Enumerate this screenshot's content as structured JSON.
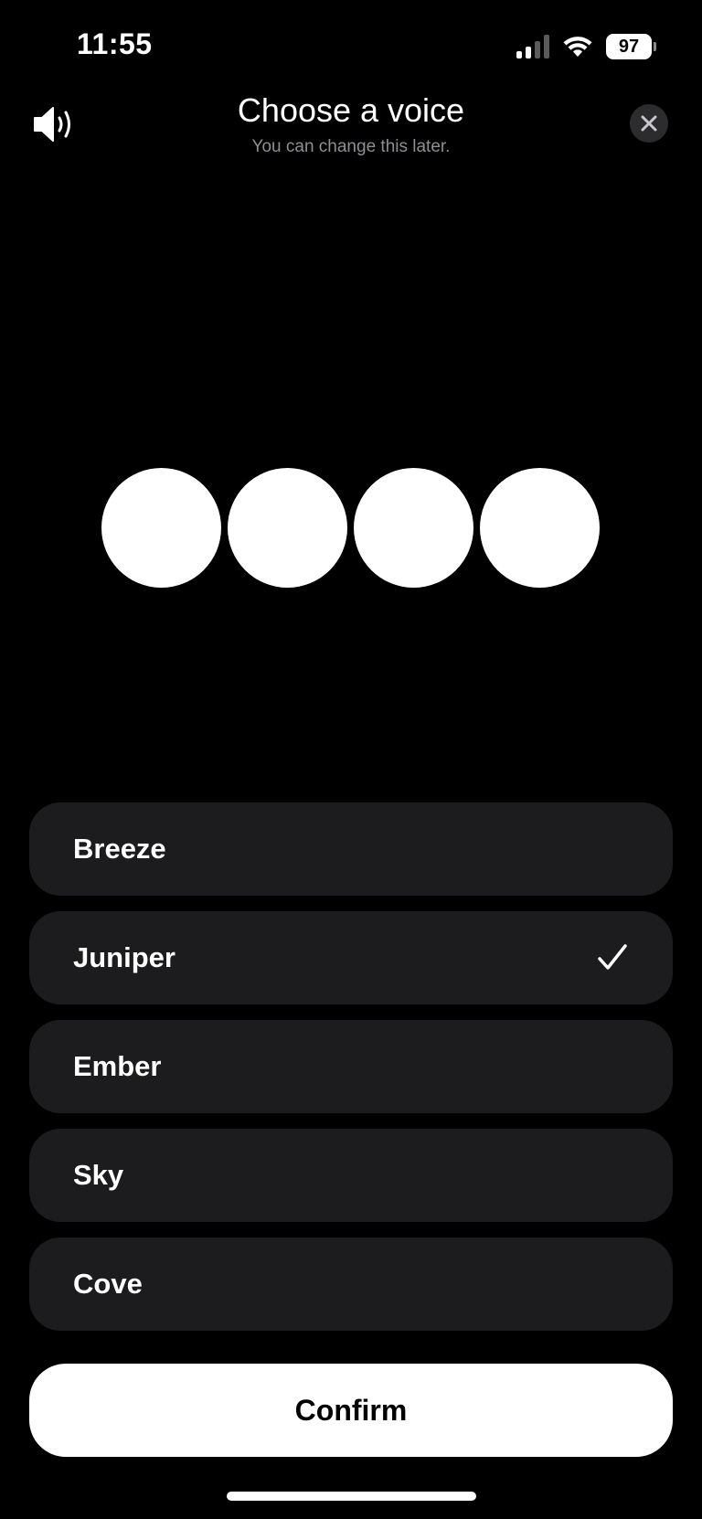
{
  "status_bar": {
    "time": "11:55",
    "battery": "97"
  },
  "header": {
    "title": "Choose a voice",
    "subtitle": "You can change this later."
  },
  "voices": [
    {
      "label": "Breeze",
      "selected": false
    },
    {
      "label": "Juniper",
      "selected": true
    },
    {
      "label": "Ember",
      "selected": false
    },
    {
      "label": "Sky",
      "selected": false
    },
    {
      "label": "Cove",
      "selected": false
    }
  ],
  "confirm_label": "Confirm",
  "icons": {
    "speaker": "speaker-wave-icon",
    "close": "close-icon",
    "check": "checkmark-icon",
    "signal": "cellular-signal-icon",
    "wifi": "wifi-icon",
    "battery": "battery-icon"
  },
  "colors": {
    "background": "#000000",
    "row": "#1c1c1e",
    "close_bg": "#2c2c2e",
    "subtitle": "#8e8e93",
    "button": "#ffffff"
  }
}
